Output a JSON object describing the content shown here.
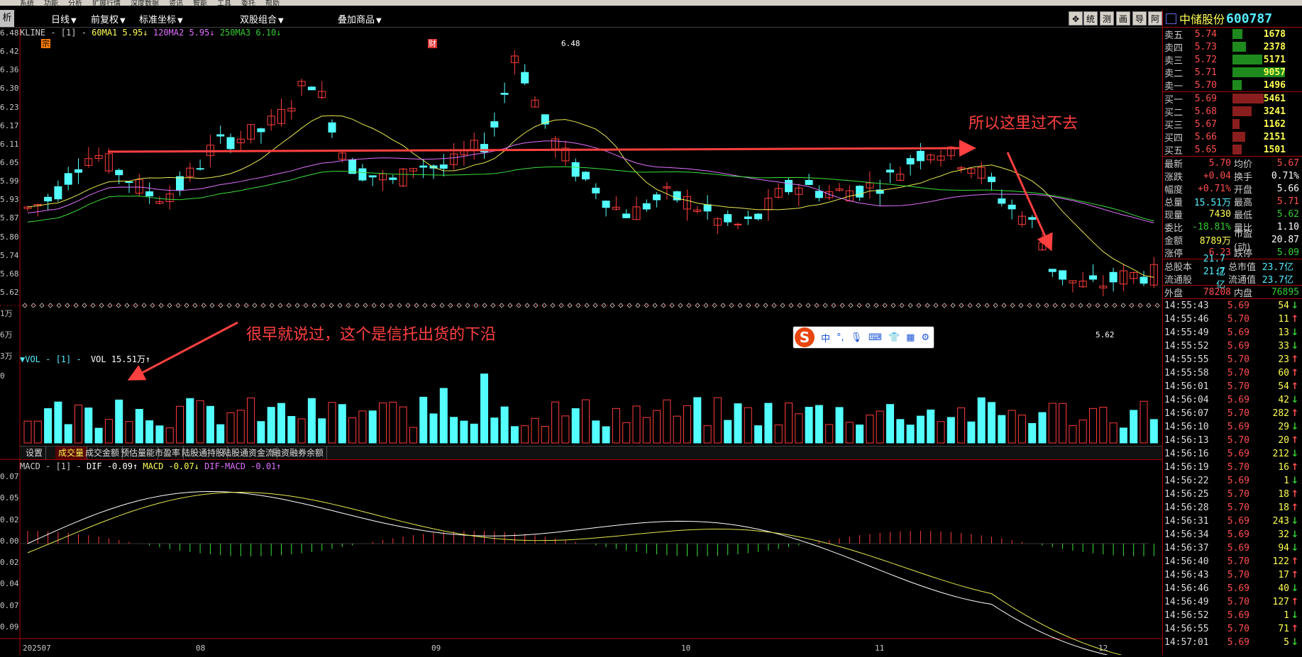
{
  "menu": [
    "系统",
    "功能",
    "分析",
    "扩展行情",
    "深度数据",
    "资讯",
    "智能",
    "工具",
    "委托",
    "帮助"
  ],
  "toolbar": {
    "left_label": "析",
    "dropdowns": [
      "日线",
      "前复权",
      "标准坐标",
      "双股组合",
      "叠加商品"
    ],
    "buttons": [
      "统",
      "测",
      "画",
      "导",
      "阿"
    ]
  },
  "kline": {
    "title": "KLINE - [1] -",
    "ma1": "60MA1 5.95↓",
    "ma2": "120MA2 5.95↓",
    "ma3": "250MA3 6.10↓",
    "high_label": "6.48",
    "low_label": "5.62",
    "markers": [
      "宗",
      "财"
    ],
    "yticks": [
      "6.48",
      "6.42",
      "6.36",
      "6.30",
      "6.23",
      "6.17",
      "6.11",
      "6.05",
      "5.99",
      "5.93",
      "5.87",
      "5.80",
      "5.74",
      "5.68",
      "5.62"
    ]
  },
  "volume": {
    "title": "▼VOL - [1] -",
    "value": "VOL 15.51万↑",
    "yticks": [
      "1万",
      "6万",
      "3万",
      "0"
    ]
  },
  "tabs": [
    "设置",
    "成交量",
    "成交金额",
    "预估量能",
    "市盈率",
    "陆股通持股",
    "陆股通资金流",
    "融资融券余额"
  ],
  "macd": {
    "title": "MACD - [1] -",
    "dif": "DIF -0.09↑",
    "macd": "MACD -0.07↓",
    "difmacd": "DIF-MACD -0.01↑",
    "yticks": [
      "0.07",
      "0.05",
      "0.02",
      "0.00",
      "0.02",
      "0.04",
      "0.07",
      "0.09"
    ]
  },
  "xaxis": [
    "202507",
    "08",
    "09",
    "10",
    "11",
    "12"
  ],
  "annotations": {
    "top": "所以这里过不去",
    "left": "很早就说过，这个是信托出货的下沿"
  },
  "ime": {
    "label_cn": "中"
  },
  "quote": {
    "name": "中储股份",
    "code": "600787",
    "asks": [
      {
        "label": "卖五",
        "price": "5.74",
        "vol": "1678",
        "pct": 0.19
      },
      {
        "label": "卖四",
        "price": "5.73",
        "vol": "2378",
        "pct": 0.26
      },
      {
        "label": "卖三",
        "price": "5.72",
        "vol": "5171",
        "pct": 0.57
      },
      {
        "label": "卖二",
        "price": "5.71",
        "vol": "9057",
        "pct": 1.0
      },
      {
        "label": "卖一",
        "price": "5.70",
        "vol": "1496",
        "pct": 0.17
      }
    ],
    "bids": [
      {
        "label": "买一",
        "price": "5.69",
        "vol": "5461",
        "pct": 0.6
      },
      {
        "label": "买二",
        "price": "5.68",
        "vol": "3241",
        "pct": 0.36
      },
      {
        "label": "买三",
        "price": "5.67",
        "vol": "1162",
        "pct": 0.13
      },
      {
        "label": "买四",
        "price": "5.66",
        "vol": "2151",
        "pct": 0.24
      },
      {
        "label": "买五",
        "price": "5.65",
        "vol": "1501",
        "pct": 0.17
      }
    ],
    "stats": [
      [
        "最新",
        "5.70",
        "均价",
        "5.67"
      ],
      [
        "涨跌",
        "+0.04",
        "换手",
        "0.71%"
      ],
      [
        "幅度",
        "+0.71%",
        "开盘",
        "5.66"
      ],
      [
        "总量",
        "15.51万",
        "最高",
        "5.71"
      ],
      [
        "现量",
        "7430",
        "最低",
        "5.62"
      ],
      [
        "委比",
        "-18.81%",
        "量比",
        "1.10"
      ],
      [
        "金额",
        "8789万",
        "市盈(动)",
        "20.87"
      ],
      [
        "涨停",
        "6.23",
        "跌停",
        "5.09"
      ]
    ],
    "capital": [
      [
        "总股本",
        "21.7亿",
        "总市值",
        "23.7亿"
      ],
      [
        "流通股",
        "21.7亿",
        "流通值",
        "23.7亿"
      ]
    ],
    "outer": [
      "外盘",
      "78208",
      "内盘",
      "76895"
    ],
    "ticks": [
      [
        "14:55:43",
        "5.69",
        "54",
        "↓"
      ],
      [
        "14:55:46",
        "5.70",
        "11",
        "↑"
      ],
      [
        "14:55:49",
        "5.69",
        "13",
        "↓"
      ],
      [
        "14:55:52",
        "5.69",
        "33",
        "↓"
      ],
      [
        "14:55:55",
        "5.70",
        "23",
        "↑"
      ],
      [
        "14:55:58",
        "5.70",
        "60",
        "↑"
      ],
      [
        "14:56:01",
        "5.70",
        "54",
        "↑"
      ],
      [
        "14:56:04",
        "5.69",
        "42",
        "↓"
      ],
      [
        "14:56:07",
        "5.70",
        "282",
        "↑"
      ],
      [
        "14:56:10",
        "5.69",
        "29",
        "↓"
      ],
      [
        "14:56:13",
        "5.70",
        "20",
        "↑"
      ],
      [
        "14:56:16",
        "5.69",
        "212",
        "↓"
      ],
      [
        "14:56:19",
        "5.70",
        "16",
        "↑"
      ],
      [
        "14:56:22",
        "5.69",
        "1",
        "↓"
      ],
      [
        "14:56:25",
        "5.70",
        "18",
        "↑"
      ],
      [
        "14:56:28",
        "5.70",
        "18",
        "↑"
      ],
      [
        "14:56:31",
        "5.69",
        "243",
        "↓"
      ],
      [
        "14:56:34",
        "5.69",
        "32",
        "↓"
      ],
      [
        "14:56:37",
        "5.69",
        "94",
        "↓"
      ],
      [
        "14:56:40",
        "5.70",
        "122",
        "↑"
      ],
      [
        "14:56:43",
        "5.70",
        "17",
        "↑"
      ],
      [
        "14:56:46",
        "5.69",
        "40",
        "↓"
      ],
      [
        "14:56:49",
        "5.70",
        "127",
        "↑"
      ],
      [
        "14:56:52",
        "5.69",
        "1",
        "↓"
      ],
      [
        "14:56:55",
        "5.70",
        "71",
        "↑"
      ],
      [
        "14:57:01",
        "5.69",
        "5",
        "↓"
      ]
    ]
  }
}
